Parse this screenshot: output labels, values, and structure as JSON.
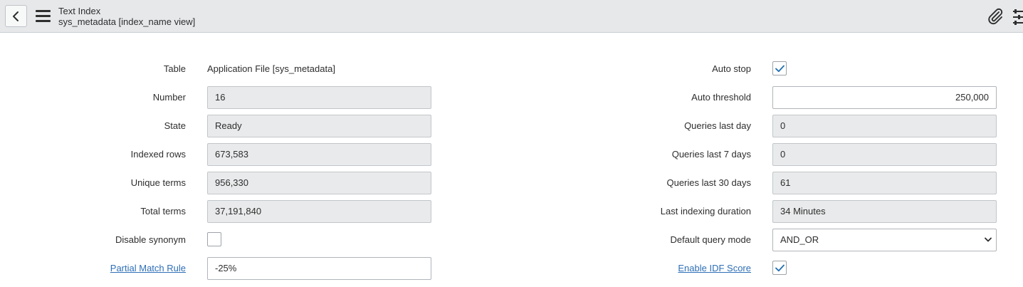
{
  "header": {
    "title": "Text Index",
    "subtitle": "sys_metadata [index_name view]"
  },
  "form": {
    "left": {
      "table": {
        "label": "Table",
        "value": "Application File [sys_metadata]"
      },
      "number": {
        "label": "Number",
        "value": "16"
      },
      "state": {
        "label": "State",
        "value": "Ready"
      },
      "indexed_rows": {
        "label": "Indexed rows",
        "value": "673,583"
      },
      "unique_terms": {
        "label": "Unique terms",
        "value": "956,330"
      },
      "total_terms": {
        "label": "Total terms",
        "value": "37,191,840"
      },
      "disable_synonym": {
        "label": "Disable synonym",
        "checked": false
      },
      "partial_match_rule": {
        "label": "Partial Match Rule",
        "value": "-25%"
      }
    },
    "right": {
      "auto_stop": {
        "label": "Auto stop",
        "checked": true
      },
      "auto_threshold": {
        "label": "Auto threshold",
        "value": "250,000"
      },
      "queries_last_day": {
        "label": "Queries last day",
        "value": "0"
      },
      "queries_last_7_days": {
        "label": "Queries last 7 days",
        "value": "0"
      },
      "queries_last_30_days": {
        "label": "Queries last 30 days",
        "value": "61"
      },
      "last_indexing_duration": {
        "label": "Last indexing duration",
        "value": "34 Minutes"
      },
      "default_query_mode": {
        "label": "Default query mode",
        "value": "AND_OR"
      },
      "enable_idf_score": {
        "label": "Enable IDF Score",
        "checked": true
      }
    }
  },
  "icons": {
    "back": "chevron-left-icon",
    "menu": "hamburger-menu-icon",
    "attachment": "paperclip-icon",
    "settings": "sliders-icon"
  },
  "colors": {
    "header_bg": "#e6e8ea",
    "readonly_bg": "#e9eaeb",
    "link": "#2e6fb7",
    "check": "#1f6fb2"
  }
}
